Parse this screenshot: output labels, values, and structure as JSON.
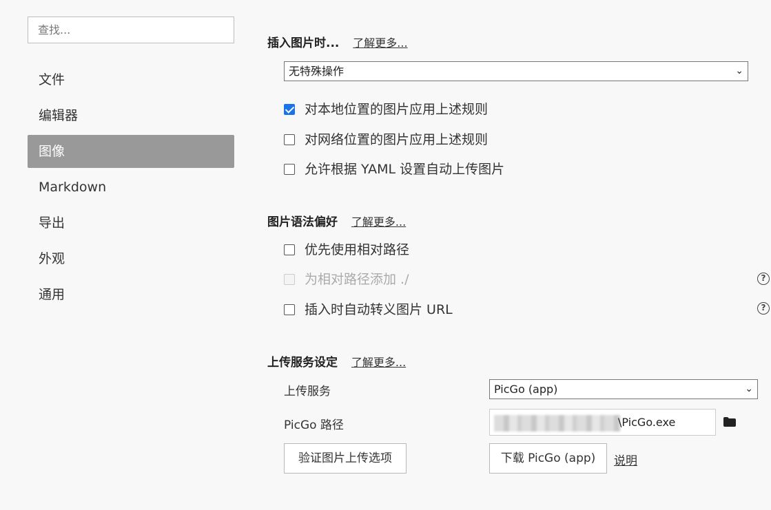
{
  "sidebar": {
    "search_placeholder": "查找...",
    "items": [
      {
        "label": "文件",
        "active": false
      },
      {
        "label": "编辑器",
        "active": false
      },
      {
        "label": "图像",
        "active": true
      },
      {
        "label": "Markdown",
        "active": false
      },
      {
        "label": "导出",
        "active": false
      },
      {
        "label": "外观",
        "active": false
      },
      {
        "label": "通用",
        "active": false
      }
    ]
  },
  "insert_image": {
    "title": "插入图片时...",
    "learn_more": "了解更多...",
    "action_select": "无特殊操作",
    "options": [
      {
        "label": "对本地位置的图片应用上述规则",
        "checked": true,
        "disabled": false
      },
      {
        "label": "对网络位置的图片应用上述规则",
        "checked": false,
        "disabled": false
      },
      {
        "label": "允许根据 YAML 设置自动上传图片",
        "checked": false,
        "disabled": false
      }
    ]
  },
  "syntax_pref": {
    "title": "图片语法偏好",
    "learn_more": "了解更多...",
    "options": [
      {
        "label": "优先使用相对路径",
        "checked": false,
        "disabled": false
      },
      {
        "label": "为相对路径添加 ./",
        "checked": false,
        "disabled": true
      },
      {
        "label": "插入时自动转义图片 URL",
        "checked": false,
        "disabled": false
      }
    ],
    "help_glyph": "?"
  },
  "upload": {
    "title": "上传服务设定",
    "learn_more": "了解更多...",
    "service_label": "上传服务",
    "service_value": "PicGo (app)",
    "path_label": "PicGo 路径",
    "path_value": "\\PicGo.exe",
    "verify_button": "验证图片上传选项",
    "download_button": "下载 PicGo (app)",
    "explain_link": "说明"
  },
  "colors": {
    "active_nav": "#999999",
    "checkbox_checked": "#1a73e8"
  }
}
